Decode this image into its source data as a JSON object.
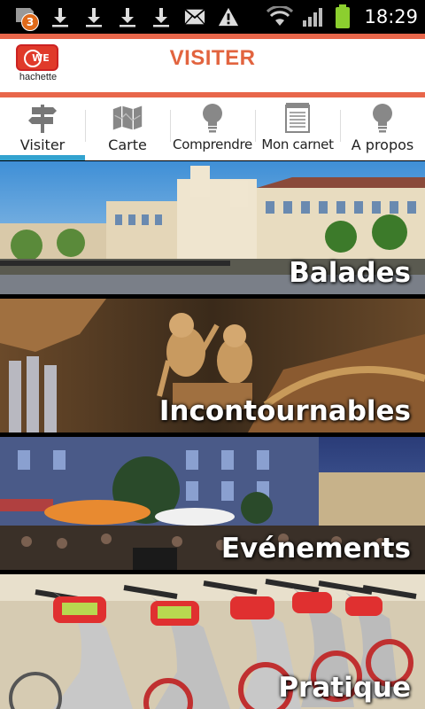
{
  "status_bar": {
    "notification_count": "3",
    "time": "18:29",
    "icons": [
      "notification-badge-icon",
      "download-icon",
      "download-icon",
      "download-icon",
      "download-icon",
      "email-icon",
      "warning-icon",
      "wifi-icon",
      "signal-icon",
      "battery-icon"
    ]
  },
  "header": {
    "logo_mark": "WE",
    "logo_label": "hachette",
    "title": "VISITER"
  },
  "tabs": [
    {
      "label": "Visiter",
      "icon": "signpost-icon",
      "active": true
    },
    {
      "label": "Carte",
      "icon": "map-icon",
      "active": false
    },
    {
      "label": "Comprendre",
      "icon": "lightbulb-icon",
      "active": false
    },
    {
      "label": "Mon carnet",
      "icon": "notepad-icon",
      "active": false
    },
    {
      "label": "A propos",
      "icon": "lightbulb-icon",
      "active": false
    }
  ],
  "tiles": [
    {
      "label": "Balades"
    },
    {
      "label": "Incontournables"
    },
    {
      "label": "Evénements"
    },
    {
      "label": "Pratique"
    }
  ],
  "colors": {
    "accent": "#e2643f",
    "tab_active": "#33a3cf",
    "logo_red": "#e03a2a"
  }
}
